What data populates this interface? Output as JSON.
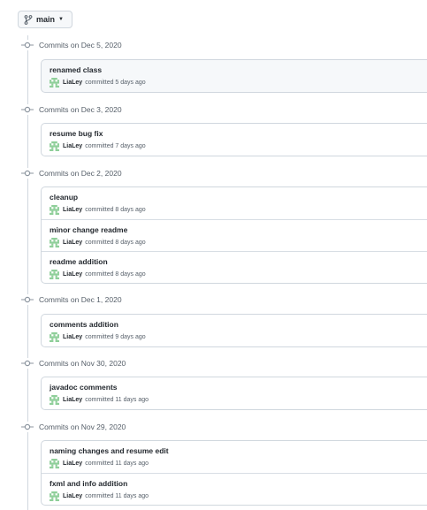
{
  "branch": {
    "label": "main"
  },
  "groups": [
    {
      "header": "Commits on Dec 5, 2020",
      "commits": [
        {
          "message": "renamed class",
          "author": "LiaLey",
          "meta": "committed 5 days ago"
        }
      ]
    },
    {
      "header": "Commits on Dec 3, 2020",
      "commits": [
        {
          "message": "resume bug fix",
          "author": "LiaLey",
          "meta": "committed 7 days ago"
        }
      ]
    },
    {
      "header": "Commits on Dec 2, 2020",
      "commits": [
        {
          "message": "cleanup",
          "author": "LiaLey",
          "meta": "committed 8 days ago"
        },
        {
          "message": "minor change readme",
          "author": "LiaLey",
          "meta": "committed 8 days ago"
        },
        {
          "message": "readme addition",
          "author": "LiaLey",
          "meta": "committed 8 days ago"
        }
      ]
    },
    {
      "header": "Commits on Dec 1, 2020",
      "commits": [
        {
          "message": "comments addition",
          "author": "LiaLey",
          "meta": "committed 9 days ago"
        }
      ]
    },
    {
      "header": "Commits on Nov 30, 2020",
      "commits": [
        {
          "message": "javadoc comments",
          "author": "LiaLey",
          "meta": "committed 11 days ago"
        }
      ]
    },
    {
      "header": "Commits on Nov 29, 2020",
      "commits": [
        {
          "message": "naming changes and resume edit",
          "author": "LiaLey",
          "meta": "committed 11 days ago"
        },
        {
          "message": "fxml and info addition",
          "author": "LiaLey",
          "meta": "committed 11 days ago"
        }
      ]
    }
  ],
  "colors": {
    "border": "#d0d7de",
    "muted_text": "#57606a",
    "text": "#24292f",
    "avatar_green": "#8fcf9a"
  },
  "icons": {
    "branch": "git-branch-icon",
    "commit": "git-commit-icon",
    "avatar": "identicon-avatar"
  }
}
